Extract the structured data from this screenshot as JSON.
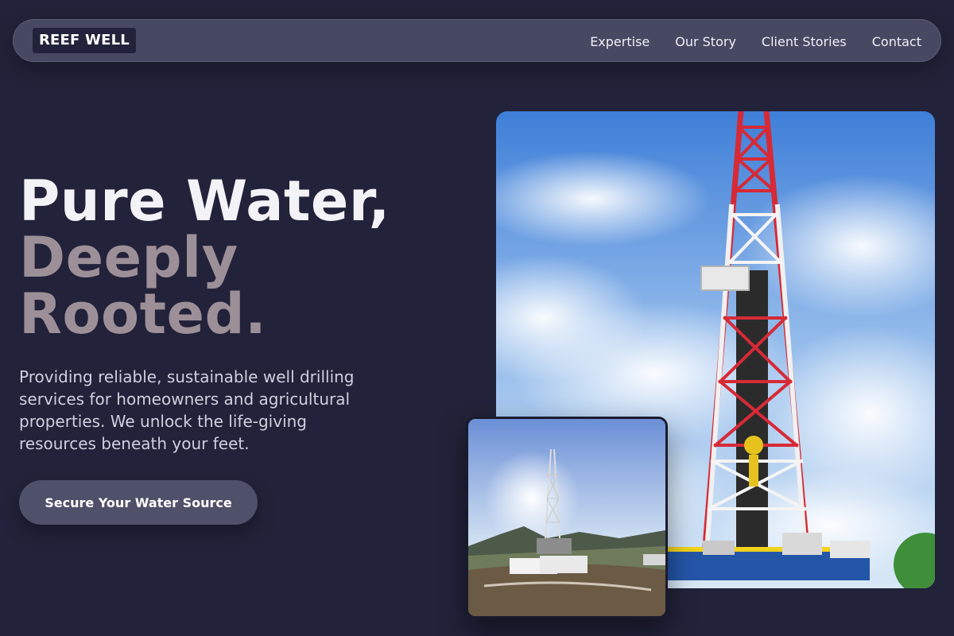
{
  "brand": {
    "logo_text": "REEF WELL"
  },
  "nav": {
    "links": [
      {
        "label": "Expertise"
      },
      {
        "label": "Our Story"
      },
      {
        "label": "Client Stories"
      },
      {
        "label": "Contact"
      }
    ]
  },
  "hero": {
    "headline_line1": "Pure Water,",
    "headline_line2": "Deeply",
    "headline_line3": "Rooted.",
    "description": "Providing reliable, sustainable well drilling services for homeowners and agricultural properties. We unlock the life-giving resources beneath your feet.",
    "cta_label": "Secure Your Water Source"
  },
  "colors": {
    "background": "#22223a",
    "nav_bg": "#474862",
    "headline_primary": "#f3f3f7",
    "headline_accent": "#9d8f98",
    "cta_bg": "#4f5069"
  }
}
